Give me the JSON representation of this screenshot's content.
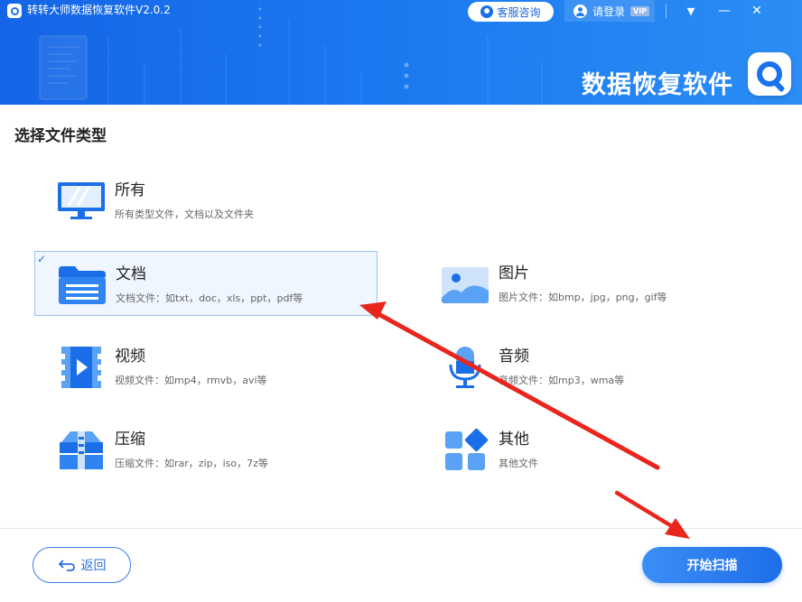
{
  "app": {
    "title": "转转大师数据恢复软件V2.0.2",
    "brand_text": "数据恢复软件"
  },
  "header": {
    "service_label": "客服咨询",
    "login_label": "请登录",
    "vip_badge": "VIP",
    "controls": {
      "menu": "▼",
      "minimize": "—",
      "close": "✕"
    }
  },
  "main": {
    "section_title": "选择文件类型",
    "types": [
      {
        "name": "所有",
        "desc": "所有类型文件，文档以及文件夹",
        "icon": "monitor-icon",
        "selected": false
      },
      {
        "name": "文档",
        "desc": "文档文件：如txt，doc，xls，ppt，pdf等",
        "icon": "folder-icon",
        "selected": true,
        "check": "✓"
      },
      {
        "name": "图片",
        "desc": "图片文件：如bmp，jpg，png，gif等",
        "icon": "image-icon",
        "selected": false
      },
      {
        "name": "视频",
        "desc": "视频文件：如mp4，rmvb，avi等",
        "icon": "video-icon",
        "selected": false
      },
      {
        "name": "音频",
        "desc": "音频文件：如mp3，wma等",
        "icon": "microphone-icon",
        "selected": false
      },
      {
        "name": "压缩",
        "desc": "压缩文件：如rar，zip，iso，7z等",
        "icon": "archive-icon",
        "selected": false
      },
      {
        "name": "其他",
        "desc": "其他文件",
        "icon": "grid-icon",
        "selected": false
      }
    ]
  },
  "footer": {
    "back_label": "返回",
    "scan_label": "开始扫描"
  },
  "colors": {
    "primary": "#1a6fe8",
    "selected_bg": "#eff6ff",
    "annotation_arrow": "#e8261e"
  }
}
